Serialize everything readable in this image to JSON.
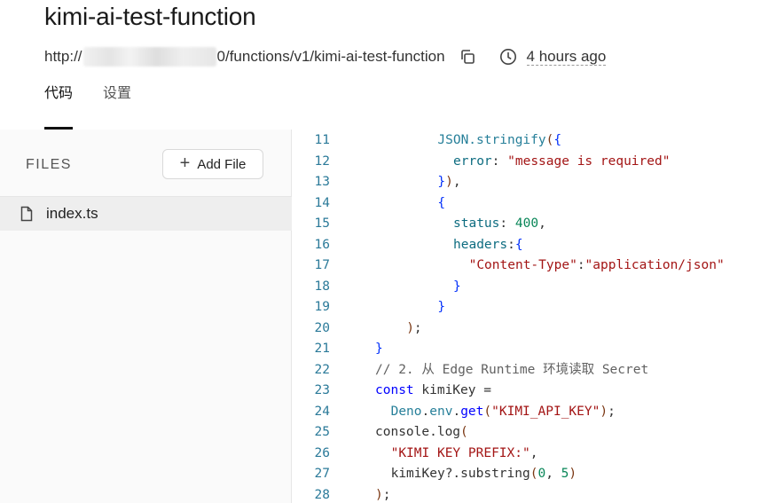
{
  "header": {
    "title": "kimi-ai-test-function",
    "url_prefix": "http://",
    "url_suffix": "0/functions/v1/kimi-ai-test-function",
    "updated": "4 hours ago"
  },
  "tabs": [
    {
      "label": "代码",
      "active": true
    },
    {
      "label": "设置",
      "active": false
    }
  ],
  "sidebar": {
    "files_label": "FILES",
    "add_file_label": "Add File",
    "files": [
      {
        "name": "index.ts",
        "selected": true
      }
    ]
  },
  "editor": {
    "lines": [
      {
        "n": "11",
        "indent": 4,
        "tokens": [
          [
            "fn",
            "JSON.stringify"
          ],
          [
            "paren",
            "("
          ],
          [
            "brace",
            "{"
          ]
        ]
      },
      {
        "n": "12",
        "indent": 5,
        "tokens": [
          [
            "key",
            "error"
          ],
          [
            "plain",
            ": "
          ],
          [
            "str",
            "\"message is required\""
          ]
        ]
      },
      {
        "n": "13",
        "indent": 4,
        "tokens": [
          [
            "brace",
            "}"
          ],
          [
            "paren",
            ")"
          ],
          [
            "plain",
            ","
          ]
        ]
      },
      {
        "n": "14",
        "indent": 4,
        "tokens": [
          [
            "brace",
            "{"
          ]
        ]
      },
      {
        "n": "15",
        "indent": 5,
        "tokens": [
          [
            "key",
            "status"
          ],
          [
            "plain",
            ": "
          ],
          [
            "num",
            "400"
          ],
          [
            "plain",
            ","
          ]
        ]
      },
      {
        "n": "16",
        "indent": 5,
        "tokens": [
          [
            "key",
            "headers"
          ],
          [
            "plain",
            ":"
          ],
          [
            "brace",
            "{"
          ]
        ]
      },
      {
        "n": "17",
        "indent": 6,
        "tokens": [
          [
            "str",
            "\"Content-Type\""
          ],
          [
            "plain",
            ":"
          ],
          [
            "str",
            "\"application/json\""
          ]
        ]
      },
      {
        "n": "18",
        "indent": 5,
        "tokens": [
          [
            "brace",
            "}"
          ]
        ]
      },
      {
        "n": "19",
        "indent": 4,
        "tokens": [
          [
            "brace",
            "}"
          ]
        ]
      },
      {
        "n": "20",
        "indent": 2,
        "tokens": [
          [
            "paren",
            ")"
          ],
          [
            "plain",
            ";"
          ]
        ]
      },
      {
        "n": "21",
        "indent": 0,
        "tokens": [
          [
            "brace",
            "}"
          ]
        ]
      },
      {
        "n": "22",
        "indent": 0,
        "tokens": [
          [
            "cm",
            "// 2. 从 Edge Runtime 环境读取 Secret"
          ]
        ]
      },
      {
        "n": "23",
        "indent": 0,
        "tokens": [
          [
            "kw",
            "const"
          ],
          [
            "plain",
            " kimiKey ="
          ]
        ]
      },
      {
        "n": "24",
        "indent": 1,
        "tokens": [
          [
            "fn",
            "Deno"
          ],
          [
            "plain",
            "."
          ],
          [
            "fn",
            "env"
          ],
          [
            "plain",
            "."
          ],
          [
            "kw",
            "get"
          ],
          [
            "paren",
            "("
          ],
          [
            "str",
            "\"KIMI_API_KEY\""
          ],
          [
            "paren",
            ")"
          ],
          [
            "plain",
            ";"
          ]
        ]
      },
      {
        "n": "25",
        "indent": 0,
        "tokens": [
          [
            "plain",
            "console.log"
          ],
          [
            "paren",
            "("
          ]
        ]
      },
      {
        "n": "26",
        "indent": 1,
        "tokens": [
          [
            "str",
            "\"KIMI KEY PREFIX:\""
          ],
          [
            "plain",
            ","
          ]
        ]
      },
      {
        "n": "27",
        "indent": 1,
        "tokens": [
          [
            "plain",
            "kimiKey?.substring"
          ],
          [
            "paren",
            "("
          ],
          [
            "num",
            "0"
          ],
          [
            "plain",
            ", "
          ],
          [
            "num",
            "5"
          ],
          [
            "paren",
            ")"
          ]
        ]
      },
      {
        "n": "28",
        "indent": 0,
        "tokens": [
          [
            "paren",
            ")"
          ],
          [
            "plain",
            ";"
          ]
        ]
      }
    ]
  }
}
